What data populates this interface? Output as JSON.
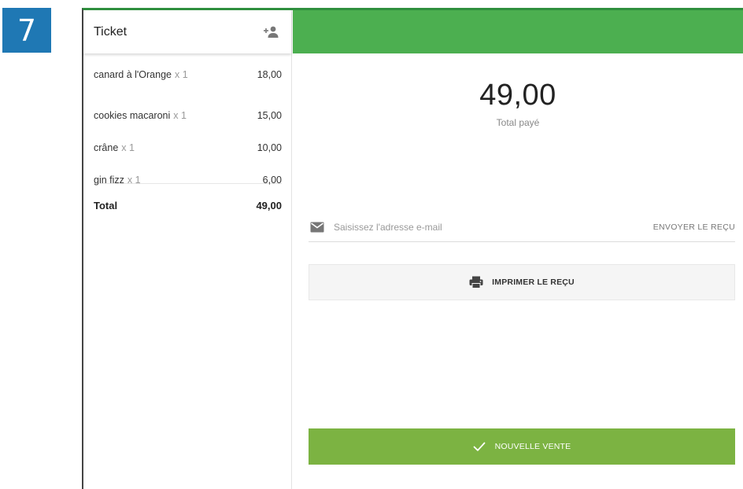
{
  "step_badge": "7",
  "ticket": {
    "title": "Ticket",
    "add_customer_icon": "add-customer-icon",
    "items": [
      {
        "name": "canard à l'Orange",
        "qty": "x 1",
        "price": "18,00"
      },
      {
        "name": "cookies macaroni",
        "qty": "x 1",
        "price": "15,00"
      },
      {
        "name": "crâne",
        "qty": "x 1",
        "price": "10,00"
      },
      {
        "name": "gin fizz",
        "qty": "x 1",
        "price": "6,00"
      }
    ],
    "total_label": "Total",
    "total_value": "49,00"
  },
  "payment": {
    "amount": "49,00",
    "amount_label": "Total payé",
    "email_placeholder": "Saisissez l'adresse e-mail",
    "email_value": "",
    "send_receipt_label": "ENVOYER LE REÇU",
    "print_receipt_label": "IMPRIMER LE REÇU",
    "new_sale_label": "NOUVELLE VENTE"
  },
  "colors": {
    "header_green": "#4caf50",
    "button_green": "#7cb342",
    "badge_blue": "#1f78b4"
  }
}
